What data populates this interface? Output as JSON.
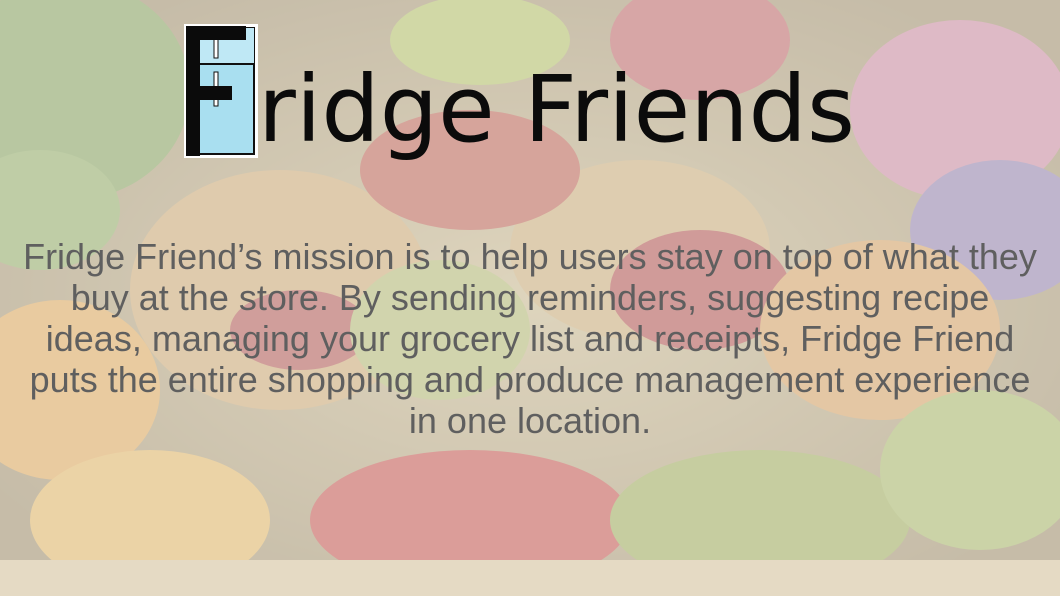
{
  "slide": {
    "title_rest": "ridge Friends",
    "mission_text": "Fridge Friend’s mission is to help users stay on top of what they buy at the store. By sending reminders, suggesting recipe ideas, managing your grocery list and receipts, Fridge Friend puts the entire shopping and produce management experience in one location."
  },
  "icons": {
    "logo": "fridge-icon",
    "background": "produce-photo"
  },
  "colors": {
    "title": "#0b0b0b",
    "body_text": "#5f5f5f",
    "fridge_body": "#a9dff0"
  }
}
